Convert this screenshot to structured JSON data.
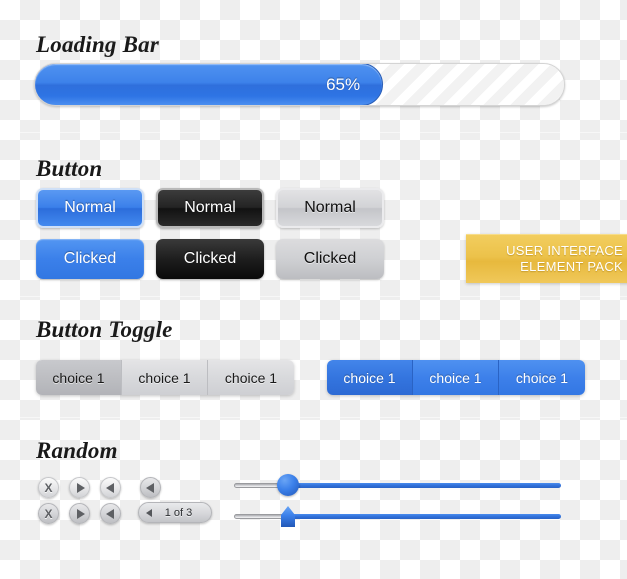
{
  "sections": {
    "loading_bar": {
      "heading": "Loading Bar",
      "progress_label": "65%",
      "progress_percent": 65
    },
    "button": {
      "heading": "Button",
      "rows": [
        {
          "state": "normal",
          "blue": "Normal",
          "dark": "Normal",
          "gray": "Normal"
        },
        {
          "state": "clicked",
          "blue": "Clicked",
          "dark": "Clicked",
          "gray": "Clicked"
        }
      ]
    },
    "button_toggle": {
      "heading": "Button Toggle",
      "gray_group": [
        "choice 1",
        "choice 1",
        "choice 1"
      ],
      "blue_group": [
        "choice 1",
        "choice 1",
        "choice 1"
      ]
    },
    "random": {
      "heading": "Random",
      "mini_buttons_row1": [
        "close-x",
        "play-right",
        "arrow-left"
      ],
      "mini_buttons_row2": [
        "close-x",
        "play-right",
        "arrow-left"
      ],
      "nav_button": "arrow-left",
      "pager_label": "1 of 3",
      "sliders": [
        {
          "knob": "round",
          "value_fraction": 0.16
        },
        {
          "knob": "pointer",
          "value_fraction": 0.16
        }
      ]
    }
  },
  "promo": {
    "line1": "USER INTERFACE",
    "line2": "ELEMENT PACK"
  },
  "glyphs": {
    "close_x": "X"
  },
  "colors": {
    "accent_blue": "#3b80ea",
    "accent_blue_dark": "#2c6ddb",
    "promo_yellow": "#ecc24a",
    "gray_button": "#d2d3d6",
    "dark_button": "#242424",
    "text_dark": "#1a1a1a",
    "text_light": "#ffffff"
  }
}
